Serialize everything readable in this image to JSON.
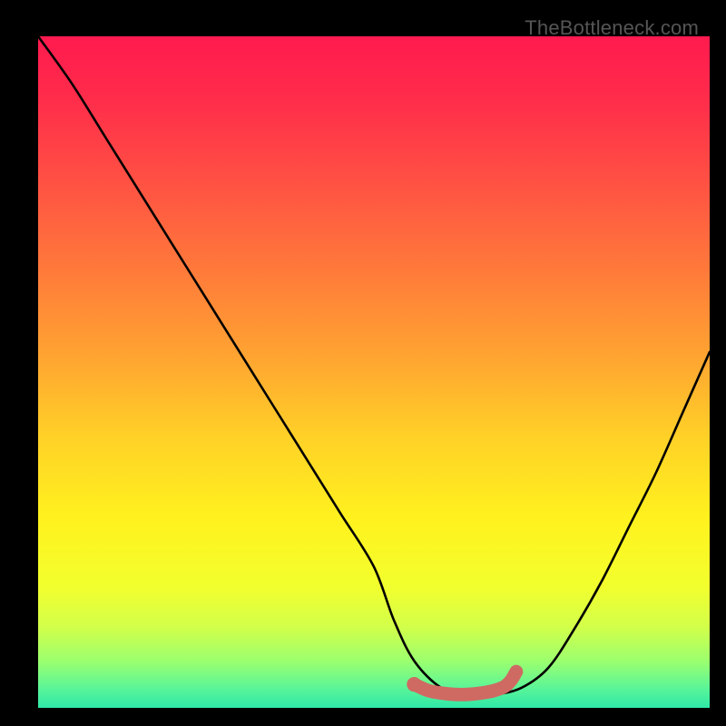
{
  "watermark": "TheBottleneck.com",
  "colors": {
    "background": "#000000",
    "curve": "#000000",
    "marker": "#cf6a63",
    "gradient_stops": [
      {
        "offset": 0.0,
        "hex": "#ff1a4f"
      },
      {
        "offset": 0.1,
        "hex": "#ff2e4a"
      },
      {
        "offset": 0.22,
        "hex": "#ff5243"
      },
      {
        "offset": 0.35,
        "hex": "#ff7a3a"
      },
      {
        "offset": 0.48,
        "hex": "#ffa531"
      },
      {
        "offset": 0.6,
        "hex": "#ffd227"
      },
      {
        "offset": 0.72,
        "hex": "#fff21e"
      },
      {
        "offset": 0.82,
        "hex": "#f2ff2e"
      },
      {
        "offset": 0.88,
        "hex": "#d2ff4a"
      },
      {
        "offset": 0.93,
        "hex": "#9cff6e"
      },
      {
        "offset": 0.97,
        "hex": "#5cf597"
      },
      {
        "offset": 1.0,
        "hex": "#2fe8a7"
      }
    ]
  },
  "chart_data": {
    "type": "line",
    "title": "",
    "xlabel": "",
    "ylabel": "",
    "xlim": [
      0,
      100
    ],
    "ylim": [
      0,
      100
    ],
    "grid": false,
    "legend": false,
    "series": [
      {
        "name": "bottleneck-curve",
        "x": [
          0,
          5,
          10,
          15,
          20,
          25,
          30,
          35,
          40,
          45,
          50,
          53,
          56,
          60,
          64,
          68,
          72,
          76,
          80,
          84,
          88,
          92,
          96,
          100
        ],
        "y": [
          100,
          93,
          85,
          77,
          69,
          61,
          53,
          45,
          37,
          29,
          21,
          13,
          7,
          3,
          2,
          2,
          3,
          6,
          12,
          19,
          27,
          35,
          44,
          53
        ]
      }
    ],
    "markers": [
      {
        "name": "optimal-range",
        "x": [
          56,
          58,
          60,
          62,
          64,
          66,
          68,
          69.5,
          70.5,
          71.2
        ],
        "y": [
          3.5,
          2.6,
          2.2,
          2.0,
          2.0,
          2.2,
          2.6,
          3.2,
          4.2,
          5.4
        ]
      }
    ]
  }
}
